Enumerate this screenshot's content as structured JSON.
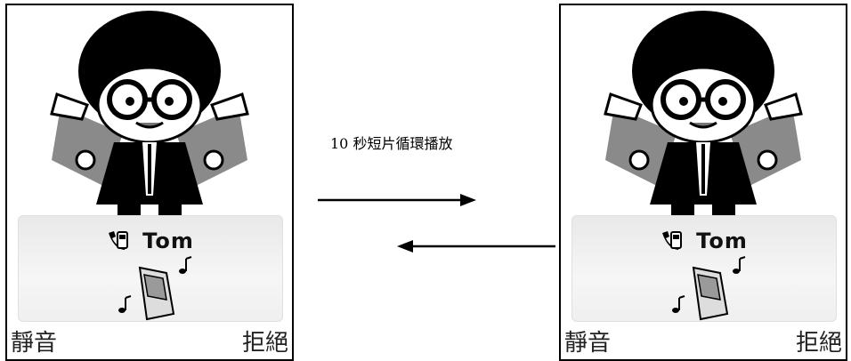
{
  "caption": "10 秒短片循環播放",
  "phones": [
    {
      "caller_name": "Tom",
      "softkey_left": "靜音",
      "softkey_right": "拒絕"
    },
    {
      "caller_name": "Tom",
      "softkey_left": "靜音",
      "softkey_right": "拒絕"
    }
  ],
  "icons": [
    "cartoon-avatar",
    "handset-icon",
    "ringing-phone-icon",
    "music-note-icon",
    "arrow-right-icon",
    "arrow-left-icon"
  ]
}
